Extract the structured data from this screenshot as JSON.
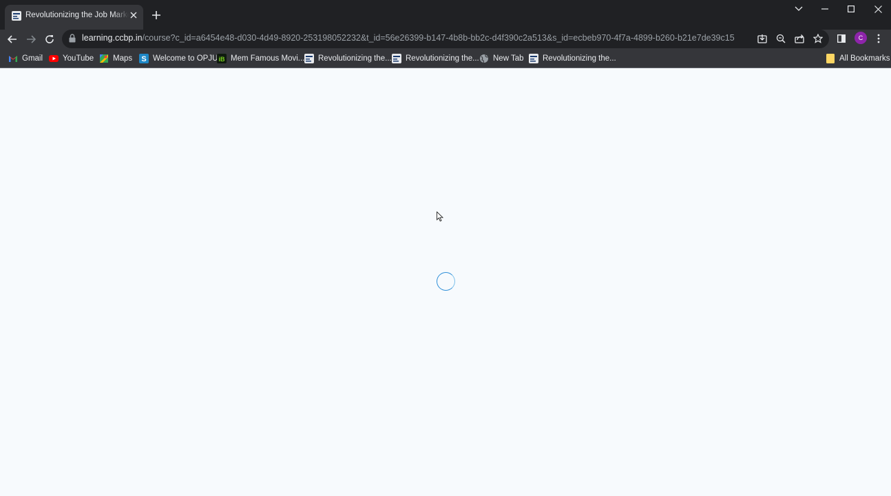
{
  "browser": {
    "tab": {
      "title": "Revolutionizing the Job Market | CCBP"
    },
    "address_bar": {
      "host": "learning.ccbp.in",
      "path": "/course?c_id=a6454e48-d030-4d49-8920-253198052232&t_id=56e26399-b147-4b8b-bb2c-d4f390c2a513&s_id=ecbeb970-4f7a-4899-b260-b21e7de39c15"
    },
    "profile_initial": "C"
  },
  "bookmarks": [
    {
      "label": "Gmail",
      "icon": "gmail-icon"
    },
    {
      "label": "YouTube",
      "icon": "youtube-icon"
    },
    {
      "label": "Maps",
      "icon": "maps-icon"
    },
    {
      "label": "Welcome to OPJU",
      "icon": "opju-icon"
    },
    {
      "label": "Mem Famous Movi...",
      "icon": "ibomma-icon"
    },
    {
      "label": "Revolutionizing the...",
      "icon": "ccbp-icon"
    },
    {
      "label": "Revolutionizing the...",
      "icon": "ccbp-icon"
    },
    {
      "label": "New Tab",
      "icon": "globe-icon"
    },
    {
      "label": "Revolutionizing the...",
      "icon": "ccbp-icon"
    }
  ],
  "all_bookmarks": {
    "label": "All Bookmarks",
    "icon": "folder-icon"
  },
  "colors": {
    "frame": "#202124",
    "toolbar": "#35363a",
    "page_background": "#f7fafd",
    "spinner": "#2e8fd8",
    "profile": "#8e24aa"
  },
  "content": {
    "state": "loading",
    "indicator_icon": "loading-spinner-icon"
  }
}
